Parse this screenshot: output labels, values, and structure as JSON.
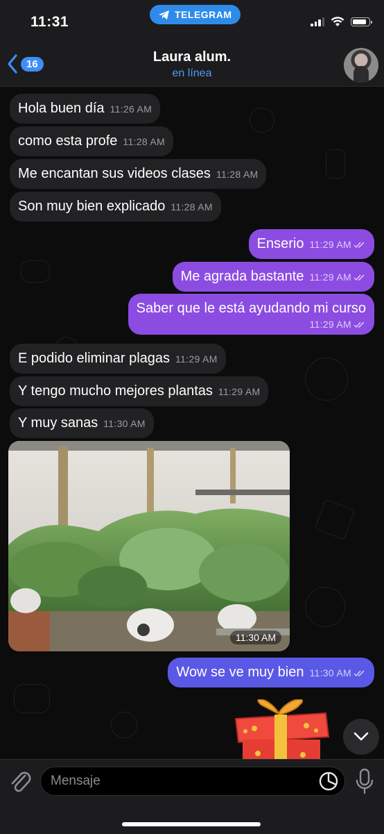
{
  "status_bar": {
    "time": "11:31",
    "app_pill": "TELEGRAM"
  },
  "header": {
    "back_count": "16",
    "title": "Laura alum.",
    "subtitle": "en línea"
  },
  "messages": [
    {
      "dir": "in",
      "text": "Hola buen día",
      "time": "11:26 AM"
    },
    {
      "dir": "in",
      "text": "como esta profe",
      "time": "11:28 AM"
    },
    {
      "dir": "in",
      "text": "Me encantan sus videos clases",
      "time": "11:28 AM"
    },
    {
      "dir": "in",
      "text": "Son muy bien explicado",
      "time": "11:28 AM"
    },
    {
      "dir": "out",
      "text": "Enserio",
      "time": "11:29 AM"
    },
    {
      "dir": "out",
      "text": "Me agrada bastante",
      "time": "11:29 AM"
    },
    {
      "dir": "out",
      "text": "Saber que le está ayudando mi curso",
      "time": "11:29 AM"
    },
    {
      "dir": "in",
      "text": "E podido eliminar plagas",
      "time": "11:29 AM"
    },
    {
      "dir": "in",
      "text": "Y tengo mucho mejores plantas",
      "time": "11:29 AM"
    },
    {
      "dir": "in",
      "text": "Y muy sanas",
      "time": "11:30 AM"
    },
    {
      "dir": "in",
      "photo": true,
      "time": "11:30 AM"
    },
    {
      "dir": "out",
      "text": "Wow se ve muy bien",
      "time": "11:30 AM"
    }
  ],
  "composer": {
    "placeholder": "Mensaje"
  },
  "colors": {
    "outgoing": "#8c4ce2",
    "incoming": "#222224",
    "accent": "#3d8ef7"
  },
  "icons": [
    "telegram-icon",
    "signal-icon",
    "wifi-icon",
    "battery-icon",
    "back-chevron-icon",
    "double-check-icon",
    "gift-sticker-icon",
    "chevron-down-icon",
    "paperclip-icon",
    "sticker-icon",
    "microphone-icon"
  ]
}
